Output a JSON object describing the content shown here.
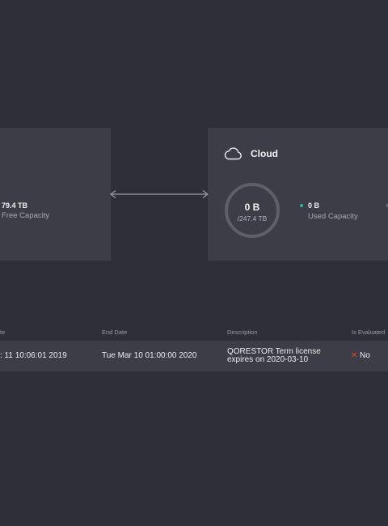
{
  "left_panel": {
    "value": "79.4 TB",
    "label": "Free Capacity"
  },
  "cloud_panel": {
    "title": "Cloud",
    "gauge_value": "0 B",
    "gauge_total": "/247.4 TB",
    "used_value": "0 B",
    "used_label": "Used Capacity",
    "used_dot_color": "#2bb3a5",
    "icon": "cloud-icon"
  },
  "license_table": {
    "headers": {
      "start": "te",
      "end": "End Date",
      "description": "Description",
      "evaluated": "Is Evaluated"
    },
    "rows": [
      {
        "start": ": 11 10:06:01 2019",
        "end": "Tue Mar 10 01:00:00 2020",
        "description": "QORESTOR Term license expires on 2020-03-10",
        "evaluated": "No",
        "evaluated_icon": "close-icon",
        "evaluated_color": "#e0483f"
      }
    ]
  }
}
